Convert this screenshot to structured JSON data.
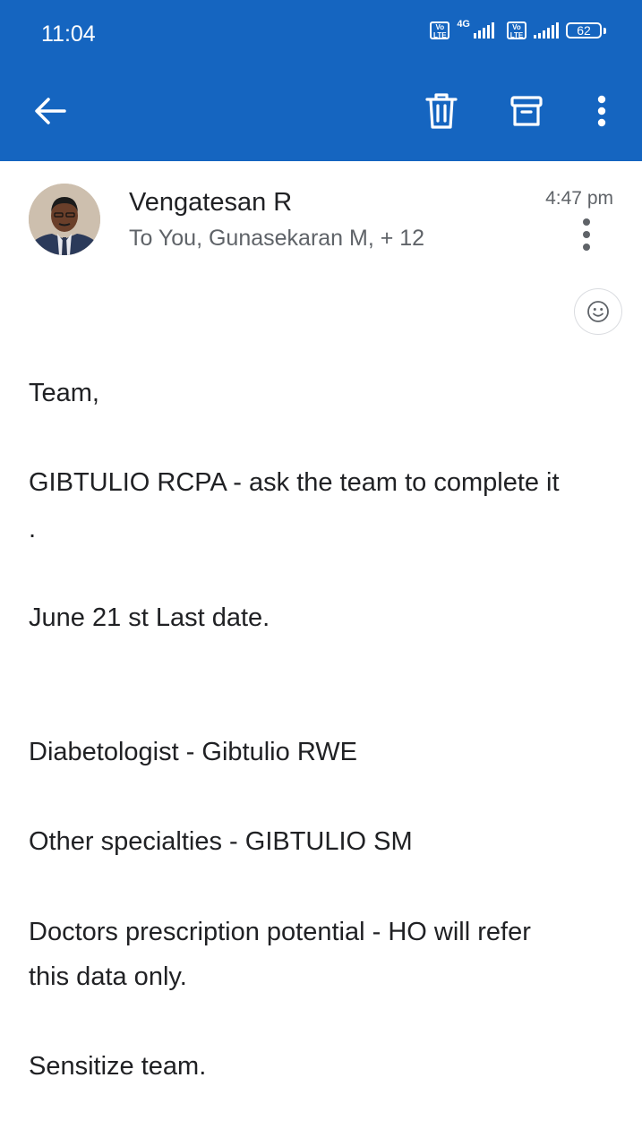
{
  "status_bar": {
    "time": "11:04",
    "network_type": "4G",
    "volte_label_1": "Vo LTE",
    "volte_label_2": "Vo LTE",
    "battery": "62"
  },
  "toolbar": {
    "back_icon": "arrow-left-icon",
    "delete_icon": "trash-icon",
    "archive_icon": "archive-icon",
    "more_icon": "more-vert-icon"
  },
  "email": {
    "sender_name": "Vengatesan R",
    "recipients": "To You, Gunasekaran M, + 12",
    "time": "4:47 pm",
    "body": {
      "line1": "Team,",
      "line2": "GIBTULIO RCPA - ask the team to complete it",
      "line3": ".",
      "line4": "June 21 st Last date.",
      "line5": "Diabetologist - Gibtulio RWE",
      "line6": "Other specialties - GIBTULIO SM",
      "line7": "Doctors prescription potential - HO will refer",
      "line8": "this data only.",
      "line9": "Sensitize team."
    }
  },
  "colors": {
    "appbar": "#1565c0",
    "text_primary": "#202124",
    "text_secondary": "#5f6368"
  }
}
